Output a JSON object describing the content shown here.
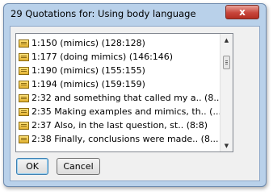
{
  "window": {
    "title": "29 Quotations for: Using body language",
    "close_label": "x"
  },
  "list": {
    "items": [
      {
        "label": "1:150 (mimics) (128:128)"
      },
      {
        "label": "1:177 (doing mimics) (146:146)"
      },
      {
        "label": "1:190 (mimics) (155:155)"
      },
      {
        "label": "1:194 (mimics) (159:159)"
      },
      {
        "label": "2:32 and something that called my a.. (8..."
      },
      {
        "label": "2:35 Making examples and mimics, th.. (..."
      },
      {
        "label": "2:37 Also, in the last question, st.. (8:8)"
      },
      {
        "label": "2:38 Finally, conclusions were made.. (8..."
      }
    ],
    "scroll_up": "▲",
    "scroll_down": "▼"
  },
  "buttons": {
    "ok_label": "OK",
    "cancel_label": "Cancel"
  }
}
